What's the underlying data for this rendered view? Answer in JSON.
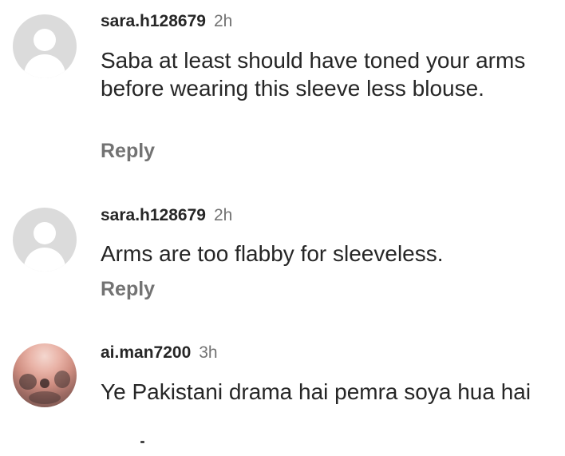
{
  "comments": [
    {
      "username": "sara.h128679",
      "time": "2h",
      "text": "Saba at least should have toned your arms before wearing this sleeve less blouse.",
      "reply_label": "Reply",
      "avatar": "default-avatar-icon"
    },
    {
      "username": "sara.h128679",
      "time": "2h",
      "text": "Arms are too flabby for sleeveless.",
      "reply_label": "Reply",
      "avatar": "default-avatar-icon"
    },
    {
      "username": "ai.man7200",
      "time": "3h",
      "text": "Ye Pakistani drama hai pemra soya hua hai",
      "avatar": "profile-photo"
    }
  ],
  "colors": {
    "text_primary": "#262626",
    "text_secondary": "#737373",
    "avatar_placeholder": "#dbdbdb",
    "background": "#ffffff"
  }
}
